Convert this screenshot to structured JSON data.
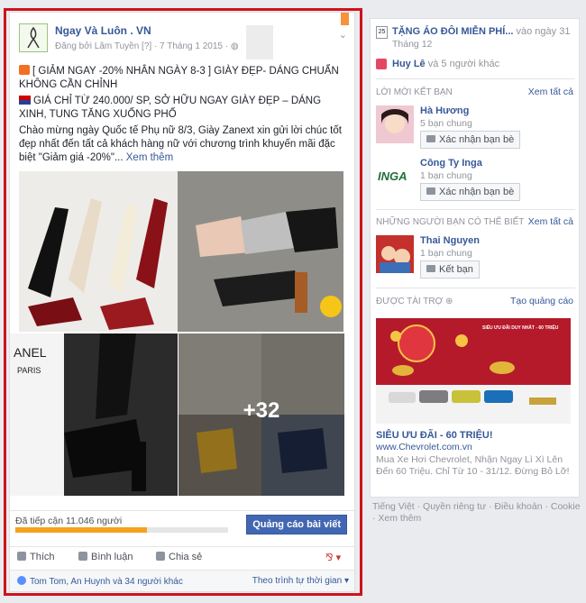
{
  "post": {
    "page_name": "Ngay Và Luôn . VN",
    "meta": "Đăng bởi Lâm Tuyền [?] · 7 Tháng 1 2015 · ",
    "text1": "[ GIẢM NGAY -20% NHÂN NGÀY 8-3 ] GIÀY ĐẸP- DÁNG CHUẨN KHÔNG CẦN CHỈNH",
    "text2": "GIÁ CHỈ TỪ 240.000/ SP, SỞ HỮU NGAY GIÀY ĐẸP – DÁNG XINH, TUNG TĂNG XUỐNG PHỐ",
    "text3": "Chào mừng ngày Quốc tế Phụ nữ 8/3, Giày Zanext xin gửi lời chúc tốt đẹp nhất đến tất cả khách hàng nữ với chương trình khuyến mãi đặc biệt \"Giảm giá -20%\"...",
    "see_more": "Xem thêm",
    "more_photos": "+32",
    "reach_text": "Đã tiếp cận 11.046 người",
    "reach_progress": 0.62,
    "promote_label": "Quảng cáo bài viết",
    "like_label": "Thích",
    "comment_label": "Bình luận",
    "share_label": "Chia sẻ",
    "likers": "Tom Tom, An Huynh và 34 người khác",
    "sort_label": "Theo trình tự thời gian"
  },
  "sidebar": {
    "event_title": "TẶNG ÁO ĐÔI MIỄN PHÍ...",
    "event_date": " vào ngày 31",
    "event_month": "Tháng 12",
    "calendar_day": "25",
    "bday_name": "Huy Lê",
    "bday_rest": " và 5 người khác",
    "requests_header": "LỜI MỜI KẾT BẠN",
    "see_all": "Xem tất cả",
    "requests": [
      {
        "name": "Hà Hương",
        "mutual": "5 bạn chung",
        "button": "Xác nhận bạn bè"
      },
      {
        "name": "Công Ty Inga",
        "mutual": "1 bạn chung",
        "button": "Xác nhận bạn bè"
      }
    ],
    "pymk_header": "NHỮNG NGƯỜI BẠN CÓ THỂ BIẾT",
    "pymk": {
      "name": "Thai Nguyen",
      "mutual": "1 bạn chung",
      "button": "Kết bạn"
    },
    "sponsored_header": "ĐƯỢC TÀI TRỢ",
    "create_ad": "Tạo quảng cáo",
    "ad_title": "SIÊU ƯU ĐÃI - 60 TRIỆU!",
    "ad_url": "www.Chevrolet.com.vn",
    "ad_desc": "Mua Xe Hơi Chevrolet, Nhận Ngay Lì Xì Lên Đến 60 Triệu. Chỉ Từ 10 - 31/12. Đừng Bỏ Lỡ!",
    "ad_banner_text": "SIÊU ƯU ĐÃI DUY NHẤT - 60 TRIỆU",
    "inga_logo": "INGA"
  },
  "footer": {
    "text": "Tiếng Việt · Quyền riêng tư · Điều khoản · Cookie · Xem thêm"
  },
  "colors": {
    "accent": "#365899",
    "highlight": "#d0121b",
    "reach": "#f4a21f"
  }
}
